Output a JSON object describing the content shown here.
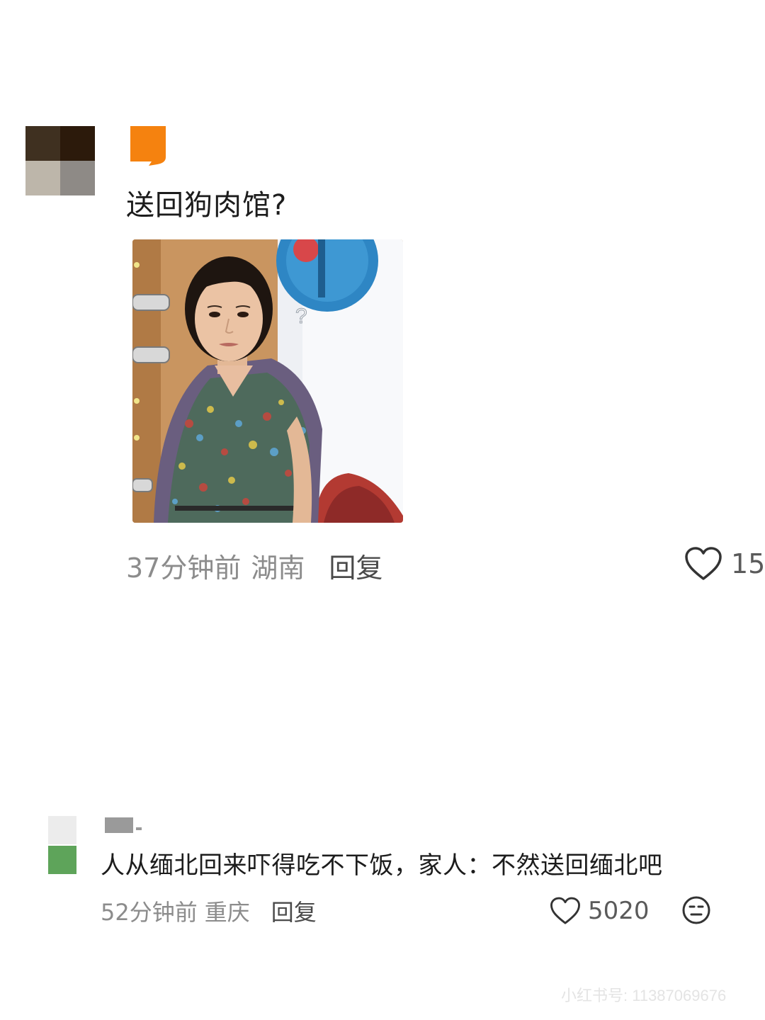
{
  "comments": [
    {
      "text": "送回狗肉馆?",
      "time": "37分钟前",
      "location": "湖南",
      "reply_label": "回复",
      "like_count": "15",
      "meme_question_mark": "?",
      "username_color": "#f5820f"
    },
    {
      "text": "人从缅北回来吓得吃不下饭，家人：不然送回缅北吧",
      "time": "52分钟前",
      "location": "重庆",
      "reply_label": "回复",
      "like_count": "5020"
    }
  ],
  "icons": {
    "like": "heart-outline-icon",
    "emoji": "meh-face-icon"
  },
  "watermark": "小红书号: 11387069676"
}
